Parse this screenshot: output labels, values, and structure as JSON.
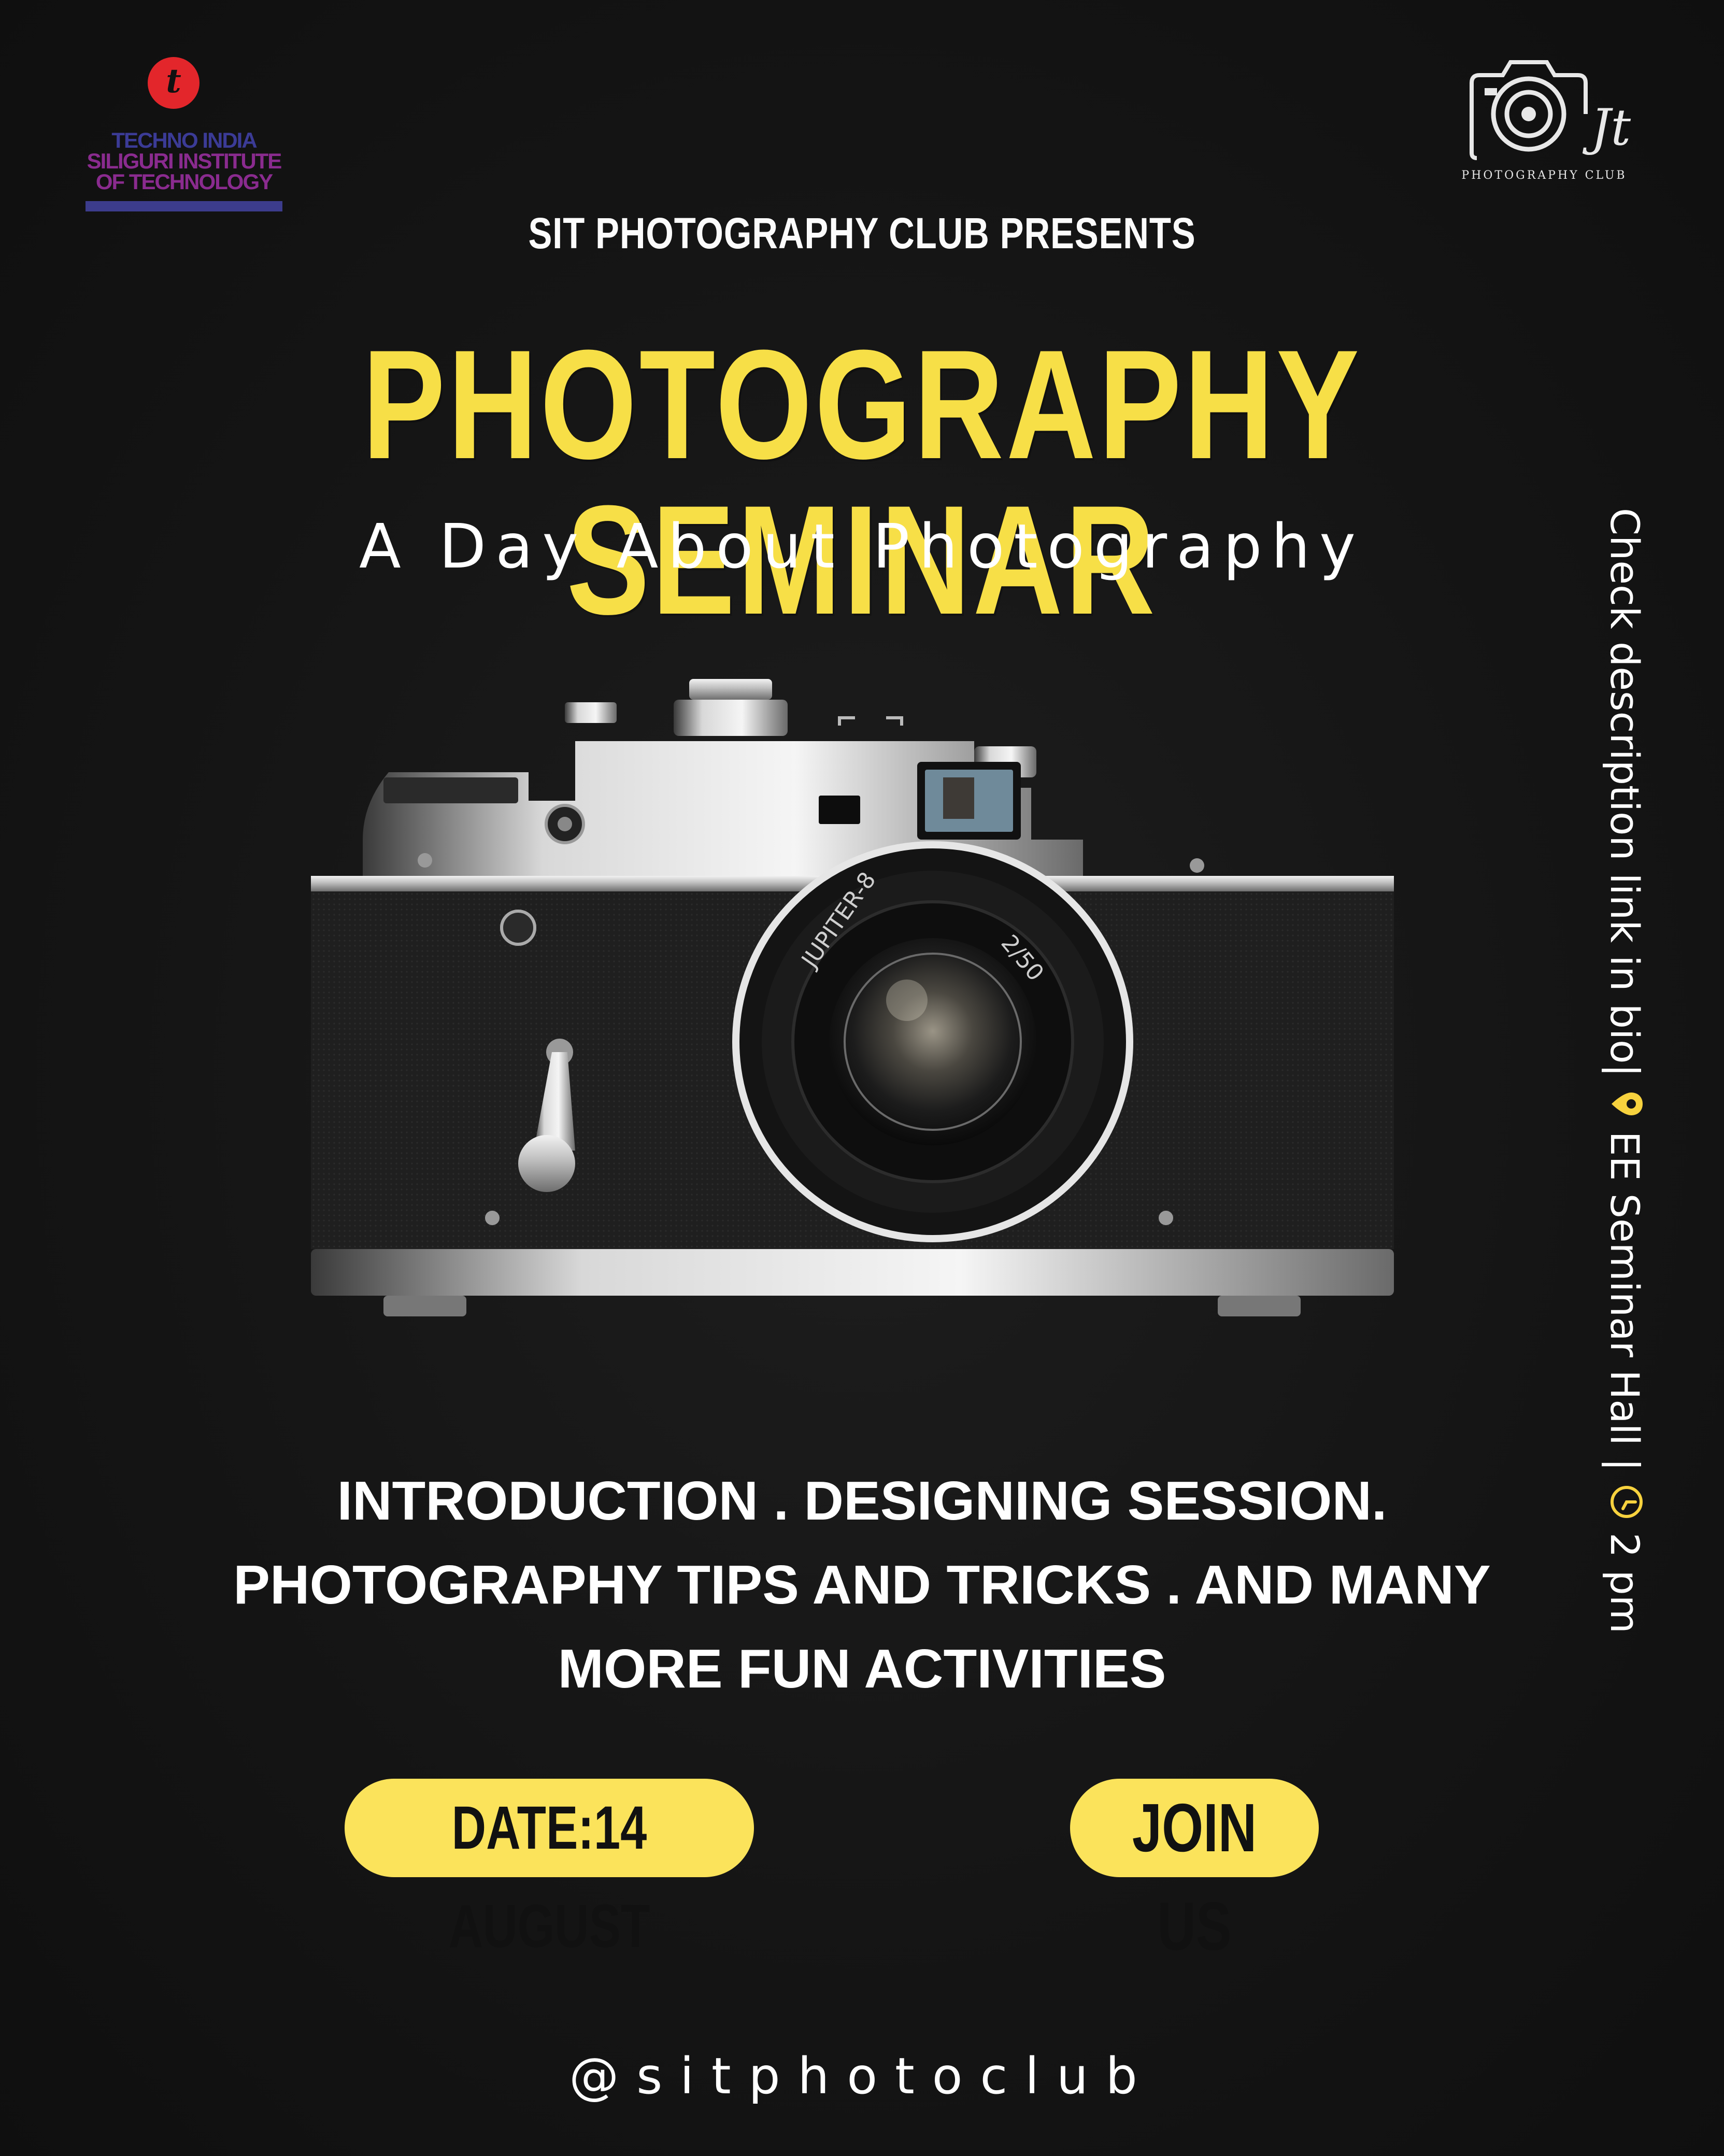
{
  "logos": {
    "institute": {
      "badge_letter": "t",
      "line1": "TECHNO INDIA",
      "line2": "SILIGURI INSTITUTE",
      "line3": "OF TECHNOLOGY"
    },
    "club": {
      "monogram": "Jt",
      "caption": "PHOTOGRAPHY CLUB"
    }
  },
  "header": {
    "presents": "SIT PHOTOGRAPHY CLUB PRESENTS",
    "title": "PHOTOGRAPHY SEMINAR",
    "subtitle": "A Day About Photography"
  },
  "camera": {
    "lens_text": "JUPITER-8",
    "aperture_text": "2/50"
  },
  "activities": {
    "lines": [
      "INTRODUCTION . DESIGNING SESSION.",
      "PHOTOGRAPHY TIPS AND TRICKS . AND MANY",
      "MORE FUN ACTIVITIES"
    ]
  },
  "buttons": {
    "date": "DATE:14 AUGUST",
    "join": "JOIN US"
  },
  "side_info": {
    "part1": "Check description link in bio|",
    "part2": "EE Seminar Hall |",
    "part3": "2 pm",
    "icons": [
      "location-pin-icon",
      "clock-icon"
    ]
  },
  "footer": {
    "handle": "@sitphotoclub"
  },
  "colors": {
    "background": "#141414",
    "accent": "#f7df47",
    "pill": "#fbe35b",
    "text": "#ffffff"
  }
}
